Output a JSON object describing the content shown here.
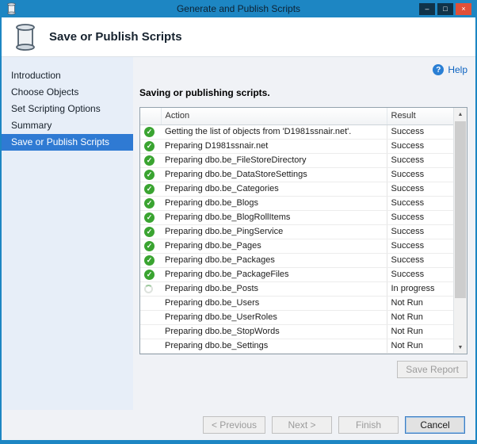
{
  "window": {
    "title": "Generate and Publish Scripts",
    "controls": {
      "minimize": "–",
      "maximize": "□",
      "close": "×"
    }
  },
  "header": {
    "title": "Save or Publish Scripts"
  },
  "sidebar": {
    "items": [
      {
        "label": "Introduction",
        "selected": false
      },
      {
        "label": "Choose Objects",
        "selected": false
      },
      {
        "label": "Set Scripting Options",
        "selected": false
      },
      {
        "label": "Summary",
        "selected": false
      },
      {
        "label": "Save or Publish Scripts",
        "selected": true
      }
    ]
  },
  "main": {
    "help": {
      "label": "Help",
      "icon_glyph": "?"
    },
    "status_text": "Saving or publishing scripts.",
    "table": {
      "columns": [
        "Action",
        "Result"
      ],
      "rows": [
        {
          "action": "Getting the list of objects from 'D1981ssnair.net'.",
          "result": "Success",
          "status": "success"
        },
        {
          "action": "Preparing D1981ssnair.net",
          "result": "Success",
          "status": "success"
        },
        {
          "action": "Preparing dbo.be_FileStoreDirectory",
          "result": "Success",
          "status": "success"
        },
        {
          "action": "Preparing dbo.be_DataStoreSettings",
          "result": "Success",
          "status": "success"
        },
        {
          "action": "Preparing dbo.be_Categories",
          "result": "Success",
          "status": "success"
        },
        {
          "action": "Preparing dbo.be_Blogs",
          "result": "Success",
          "status": "success"
        },
        {
          "action": "Preparing dbo.be_BlogRollItems",
          "result": "Success",
          "status": "success"
        },
        {
          "action": "Preparing dbo.be_PingService",
          "result": "Success",
          "status": "success"
        },
        {
          "action": "Preparing dbo.be_Pages",
          "result": "Success",
          "status": "success"
        },
        {
          "action": "Preparing dbo.be_Packages",
          "result": "Success",
          "status": "success"
        },
        {
          "action": "Preparing dbo.be_PackageFiles",
          "result": "Success",
          "status": "success"
        },
        {
          "action": "Preparing dbo.be_Posts",
          "result": "In progress",
          "status": "in-progress"
        },
        {
          "action": "Preparing dbo.be_Users",
          "result": "Not Run",
          "status": "not-run"
        },
        {
          "action": "Preparing dbo.be_UserRoles",
          "result": "Not Run",
          "status": "not-run"
        },
        {
          "action": "Preparing dbo.be_StopWords",
          "result": "Not Run",
          "status": "not-run"
        },
        {
          "action": "Preparing dbo.be_Settings",
          "result": "Not Run",
          "status": "not-run"
        }
      ]
    },
    "save_report_label": "Save Report"
  },
  "footer": {
    "buttons": [
      {
        "label": "< Previous",
        "name": "previous-button",
        "enabled": false,
        "default": false
      },
      {
        "label": "Next >",
        "name": "next-button",
        "enabled": false,
        "default": false
      },
      {
        "label": "Finish",
        "name": "finish-button",
        "enabled": false,
        "default": false
      },
      {
        "label": "Cancel",
        "name": "cancel-button",
        "enabled": true,
        "default": true
      }
    ]
  },
  "icons": {
    "check": "✓",
    "scroll_up": "▲",
    "scroll_down": "▼"
  },
  "colors": {
    "titlebar": "#1d86c3",
    "accent": "#2f7ad3",
    "success": "#3aa431",
    "close": "#e05038",
    "help": "#0b62c0",
    "sidebar-bg": "#e7eef8"
  }
}
